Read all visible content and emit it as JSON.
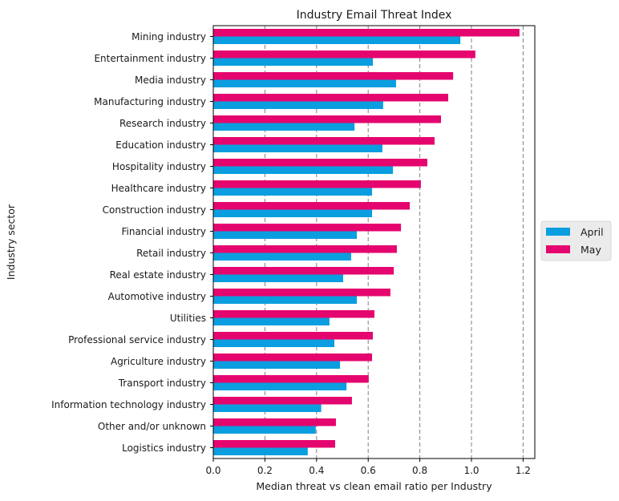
{
  "chart_data": {
    "type": "bar",
    "orientation": "horizontal",
    "title": "Industry Email Threat Index",
    "xlabel": "Median threat vs clean email ratio per Industry",
    "ylabel": "Industry sector",
    "xlim": [
      0,
      1.25
    ],
    "xticks": [
      "0.0",
      "0.2",
      "0.4",
      "0.6",
      "0.8",
      "1.0",
      "1.2"
    ],
    "xtick_values": [
      0,
      0.2,
      0.4,
      0.6,
      0.8,
      1.0,
      1.2
    ],
    "grid": "vertical dashed",
    "legend_position": "right",
    "categories": [
      "Mining industry",
      "Entertainment industry",
      "Media industry",
      "Manufacturing industry",
      "Research industry",
      "Education industry",
      "Hospitality industry",
      "Healthcare industry",
      "Construction industry",
      "Financial industry",
      "Retail industry",
      "Real estate industry",
      "Automotive industry",
      "Utilities",
      "Professional service industry",
      "Agriculture industry",
      "Transport industry",
      "Information technology industry",
      "Other and/or unknown",
      "Logistics industry"
    ],
    "series": [
      {
        "name": "April",
        "color": "#0a9ee0",
        "values": [
          0.957,
          0.618,
          0.708,
          0.658,
          0.547,
          0.655,
          0.696,
          0.615,
          0.615,
          0.556,
          0.534,
          0.503,
          0.556,
          0.45,
          0.469,
          0.491,
          0.516,
          0.418,
          0.397,
          0.366
        ]
      },
      {
        "name": "May",
        "color": "#e5056e",
        "values": [
          1.186,
          1.015,
          0.929,
          0.91,
          0.882,
          0.857,
          0.829,
          0.804,
          0.761,
          0.727,
          0.711,
          0.699,
          0.686,
          0.624,
          0.618,
          0.615,
          0.602,
          0.537,
          0.475,
          0.472
        ]
      }
    ]
  }
}
